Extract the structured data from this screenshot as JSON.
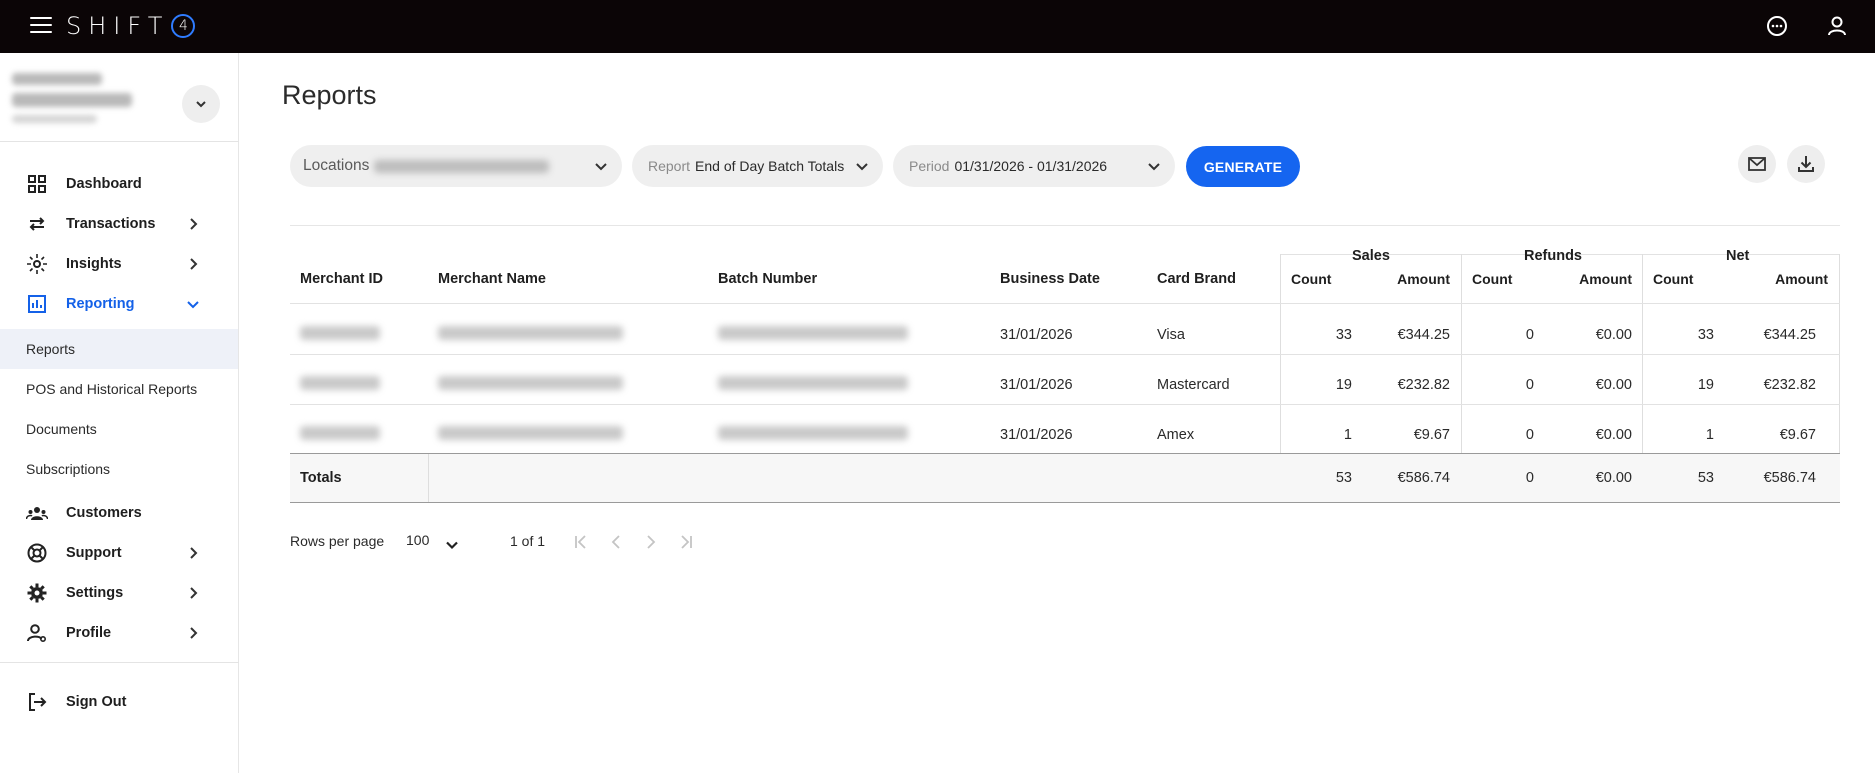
{
  "topbar": {
    "logo_text": "SHIFT",
    "logo_mark": "4",
    "icons": [
      "menu-icon",
      "chat-icon",
      "user-icon"
    ]
  },
  "sidebar": {
    "nav": [
      {
        "label": "Dashboard",
        "icon": "grid-icon",
        "has_chevron": false
      },
      {
        "label": "Transactions",
        "icon": "arrows-icon",
        "has_chevron": true
      },
      {
        "label": "Insights",
        "icon": "sparkle-icon",
        "has_chevron": true
      },
      {
        "label": "Reporting",
        "icon": "bar-chart-icon",
        "has_chevron": true,
        "expanded": true
      }
    ],
    "reporting_sub": [
      {
        "label": "Reports",
        "selected": true
      },
      {
        "label": "POS and Historical Reports"
      },
      {
        "label": "Documents"
      },
      {
        "label": "Subscriptions"
      }
    ],
    "nav2": [
      {
        "label": "Customers",
        "icon": "customers-icon"
      },
      {
        "label": "Support",
        "icon": "lifebuoy-icon"
      },
      {
        "label": "Settings",
        "icon": "gear-icon"
      },
      {
        "label": "Profile",
        "icon": "profile-icon"
      }
    ],
    "sign_out": "Sign Out"
  },
  "page": {
    "title": "Reports",
    "filters": {
      "locations_label": "Locations",
      "report_label": "Report",
      "report_value": "End of Day Batch Totals",
      "period_label": "Period",
      "period_value": "01/31/2026 - 01/31/2026"
    },
    "generate_label": "GENERATE"
  },
  "table": {
    "group_headers": {
      "sales": "Sales",
      "refunds": "Refunds",
      "net": "Net"
    },
    "headers": {
      "merchant_id": "Merchant ID",
      "merchant_name": "Merchant Name",
      "batch_number": "Batch Number",
      "business_date": "Business Date",
      "card_brand": "Card Brand",
      "count": "Count",
      "amount": "Amount"
    },
    "rows": [
      {
        "date": "31/01/2026",
        "brand": "Visa",
        "sales_count": "33",
        "sales_amount": "€344.25",
        "refunds_count": "0",
        "refunds_amount": "€0.00",
        "net_count": "33",
        "net_amount": "€344.25"
      },
      {
        "date": "31/01/2026",
        "brand": "Mastercard",
        "sales_count": "19",
        "sales_amount": "€232.82",
        "refunds_count": "0",
        "refunds_amount": "€0.00",
        "net_count": "19",
        "net_amount": "€232.82"
      },
      {
        "date": "31/01/2026",
        "brand": "Amex",
        "sales_count": "1",
        "sales_amount": "€9.67",
        "refunds_count": "0",
        "refunds_amount": "€0.00",
        "net_count": "1",
        "net_amount": "€9.67"
      }
    ],
    "totals": {
      "label": "Totals",
      "sales_count": "53",
      "sales_amount": "€586.74",
      "refunds_count": "0",
      "refunds_amount": "€0.00",
      "net_count": "53",
      "net_amount": "€586.74"
    }
  },
  "pagination": {
    "rows_per_page_label": "Rows per page",
    "rows_per_page_value": "100",
    "page_info": "1 of 1"
  }
}
